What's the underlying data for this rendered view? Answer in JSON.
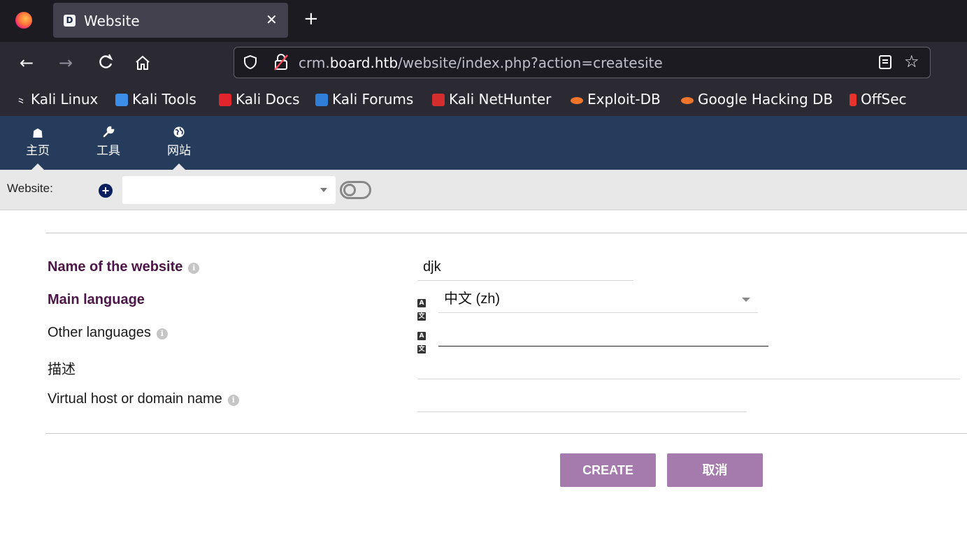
{
  "browser": {
    "tab_title": "Website",
    "tab_favicon": "D",
    "url_host_prefix": "crm.",
    "url_host_main": "board.htb",
    "url_path": "/website/index.php?action=createsite",
    "nav_icons": {
      "back": "←",
      "forward": "→",
      "reload": "C",
      "home": "⌂",
      "star": "☆",
      "new_tab": "+",
      "close": "✕"
    },
    "bookmarks": [
      {
        "label": "Kali Linux",
        "icon_color": "#ffffff"
      },
      {
        "label": "Kali Tools",
        "icon_color": "#3c8ee8"
      },
      {
        "label": "Kali Docs",
        "icon_color": "#e2252c"
      },
      {
        "label": "Kali Forums",
        "icon_color": "#2f7fd8"
      },
      {
        "label": "Kali NetHunter",
        "icon_color": "#d42d2d"
      },
      {
        "label": "Exploit-DB",
        "icon_color": "#f0762b"
      },
      {
        "label": "Google Hacking DB",
        "icon_color": "#f0762b"
      },
      {
        "label": "OffSec",
        "icon_color": "#e8322e"
      }
    ]
  },
  "app": {
    "topmenu": [
      {
        "icon": "☗",
        "label": "主页"
      },
      {
        "icon": "🔧",
        "label": "工具"
      },
      {
        "icon": "◍",
        "label": "网站"
      }
    ],
    "website_bar": {
      "label": "Website:",
      "add_icon": "+",
      "select_value": ""
    },
    "form": {
      "name_label": "Name of the website",
      "name_value": "djk",
      "main_language_label": "Main language",
      "main_language_value": "中文 (zh)",
      "other_languages_label": "Other languages",
      "other_languages_value": "",
      "description_label": "描述",
      "description_value": "",
      "vhost_label": "Virtual host or domain name",
      "vhost_value": "",
      "info_glyph": "i"
    },
    "buttons": {
      "create": "CREATE",
      "cancel": "取消"
    },
    "colors": {
      "topmenu_bg": "#263c5c",
      "required_label": "#4c1748",
      "button_bg": "#a57aad"
    }
  }
}
